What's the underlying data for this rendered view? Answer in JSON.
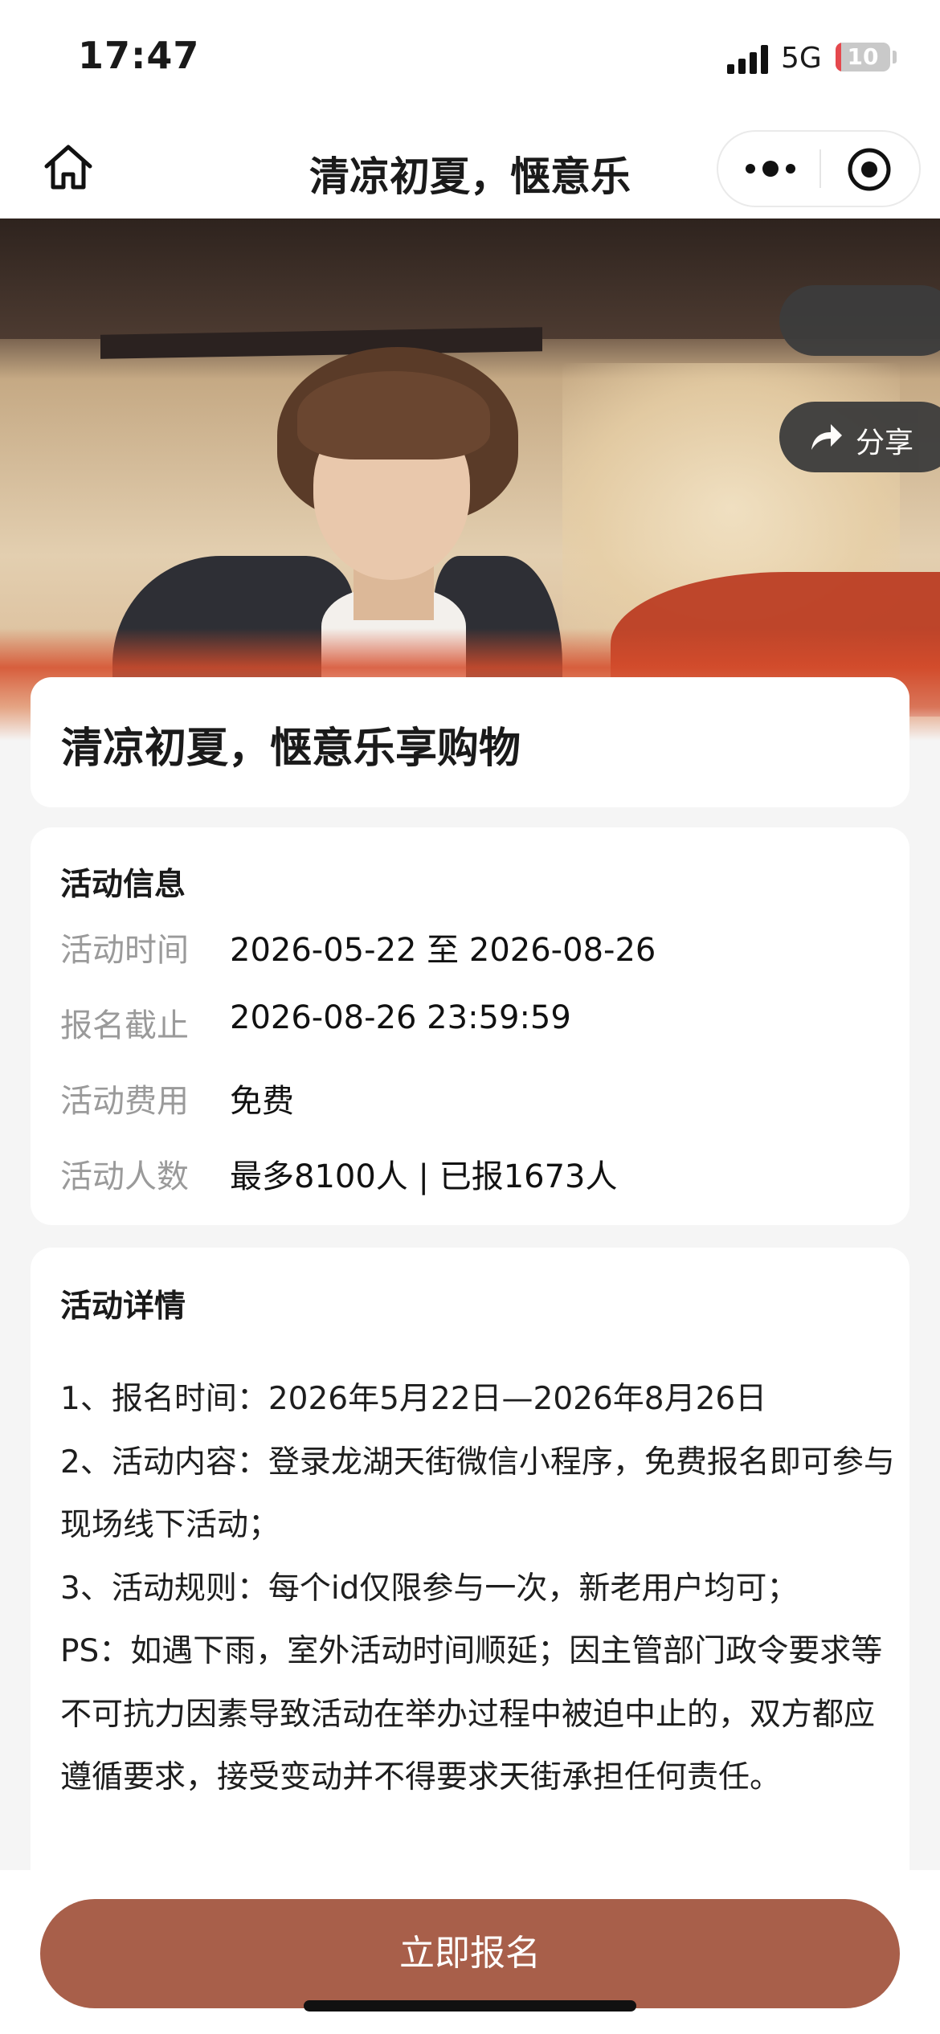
{
  "status_bar": {
    "time": "17:47",
    "network": "5G",
    "battery": {
      "level_percent": 10,
      "label": "10"
    }
  },
  "nav_bar": {
    "title": "清凉初夏，惬意乐",
    "icons": [
      "home-icon",
      "more-icon",
      "target-icon"
    ]
  },
  "banner": {
    "side_buttons": {
      "share_label": "分享"
    }
  },
  "event": {
    "title": "清凉初夏，惬意乐享购物"
  },
  "info": {
    "section_title": "活动信息",
    "rows": [
      {
        "label": "活动时间",
        "value": "2026-05-22 至 2026-08-26"
      },
      {
        "label": "报名截止",
        "value": "2026-08-26 23:59:59"
      },
      {
        "label": "活动费用",
        "value": "免费"
      },
      {
        "label": "活动人数",
        "value": "最多8100人 | 已报1673人"
      }
    ]
  },
  "details": {
    "section_title": "活动详情",
    "paragraphs": [
      "1、报名时间：2026年5月22日—2026年8月26日",
      "2、活动内容：登录龙湖天街微信小程序，免费报名即可参与现场线下活动；",
      "3、活动规则：每个id仅限参与一次，新老用户均可；",
      "PS：如遇下雨，室外活动时间顺延；因主管部门政令要求等不可抗力因素导致活动在举办过程中被迫中止的，双方都应遵循要求，接受变动并不得要求天街承担任何责任。"
    ]
  },
  "footer": {
    "signup_label": "立即报名",
    "button_color": "#a85f4a"
  }
}
